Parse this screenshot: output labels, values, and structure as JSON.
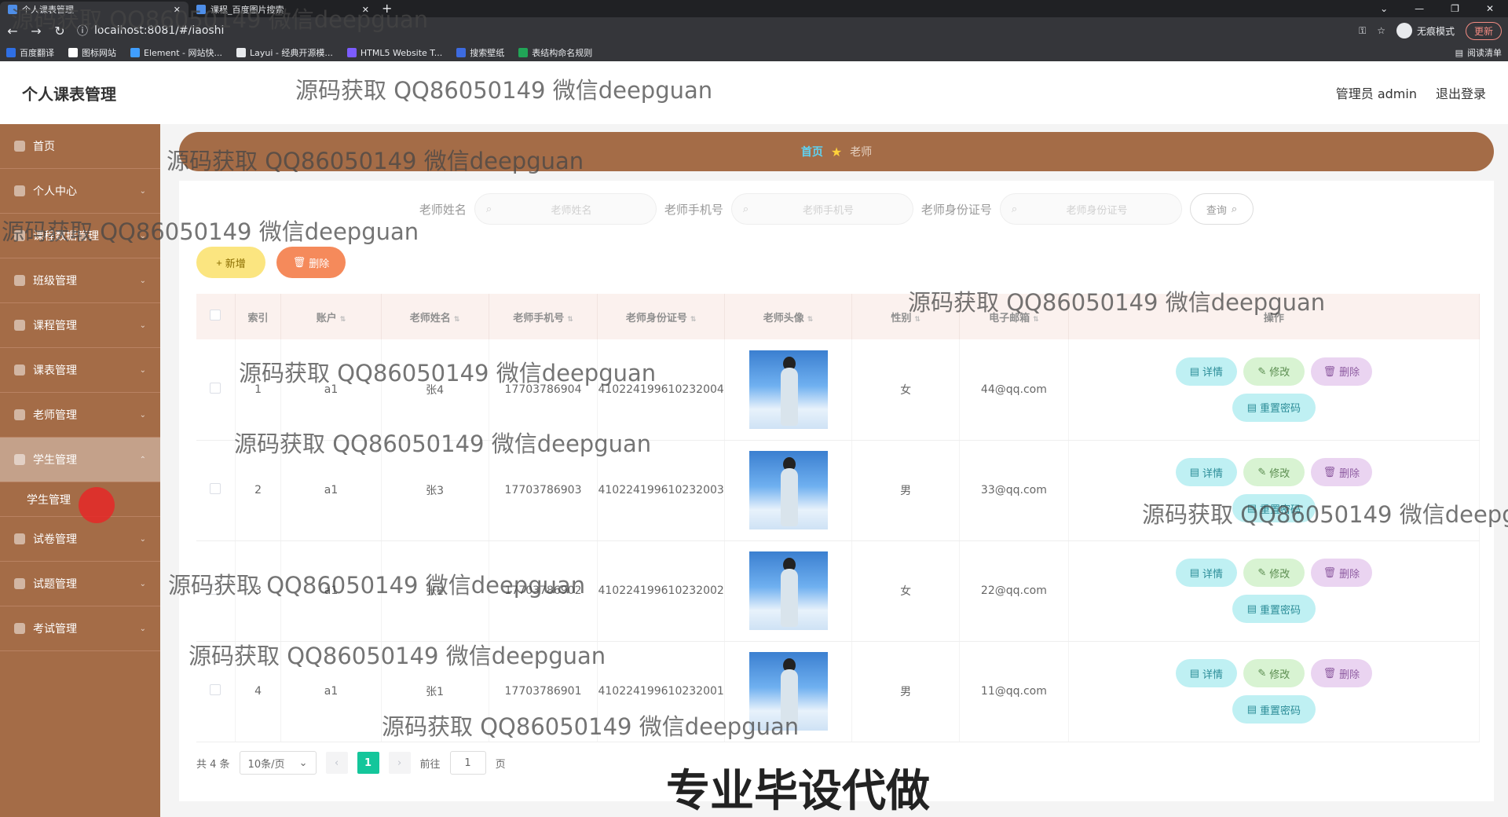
{
  "browser": {
    "tabs": [
      {
        "label": "个人课表管理",
        "active": true
      },
      {
        "label": "课程_百度图片搜索",
        "active": false
      }
    ],
    "url": "localhost:8081/#/laoshi",
    "incognito_label": "无痕模式",
    "update_label": "更新",
    "bookmarks": [
      {
        "label": "百度翻译",
        "color": "#2f6fe4"
      },
      {
        "label": "图标网站",
        "color": "#ffffff"
      },
      {
        "label": "Element - 网站快...",
        "color": "#409eff"
      },
      {
        "label": "Layui - 经典开源模...",
        "color": "#e8eaed"
      },
      {
        "label": "HTML5 Website T...",
        "color": "#7c5cff"
      },
      {
        "label": "搜索壁纸",
        "color": "#3d6be0"
      },
      {
        "label": "表结构命名规则",
        "color": "#21a557"
      }
    ],
    "reading_list": "阅读清单"
  },
  "header": {
    "title": "个人课表管理",
    "user": "管理员 admin",
    "logout": "退出登录"
  },
  "sidebar": {
    "items": [
      {
        "label": "首页"
      },
      {
        "label": "个人中心"
      },
      {
        "label": "课程数据管理"
      },
      {
        "label": "班级管理"
      },
      {
        "label": "课程管理"
      },
      {
        "label": "课表管理"
      },
      {
        "label": "老师管理"
      },
      {
        "label": "学生管理"
      },
      {
        "label": "试卷管理"
      },
      {
        "label": "试题管理"
      },
      {
        "label": "考试管理"
      }
    ],
    "submenu": "学生管理"
  },
  "breadcrumb": {
    "home": "首页",
    "current": "老师"
  },
  "search": {
    "name_label": "老师姓名",
    "name_placeholder": "老师姓名",
    "phone_label": "老师手机号",
    "phone_placeholder": "老师手机号",
    "idcard_label": "老师身份证号",
    "idcard_placeholder": "老师身份证号",
    "query_button": "查询"
  },
  "actions": {
    "add": "新增",
    "delete": "删除"
  },
  "table": {
    "headers": [
      "索引",
      "账户",
      "老师姓名",
      "老师手机号",
      "老师身份证号",
      "老师头像",
      "性别",
      "电子邮箱",
      "操作"
    ],
    "rows": [
      {
        "index": "1",
        "account": "a1",
        "name": "张4",
        "phone": "17703786904",
        "idcard": "410224199610232004",
        "gender": "女",
        "email": "44@qq.com"
      },
      {
        "index": "2",
        "account": "a1",
        "name": "张3",
        "phone": "17703786903",
        "idcard": "410224199610232003",
        "gender": "男",
        "email": "33@qq.com"
      },
      {
        "index": "3",
        "account": "a1",
        "name": "张2",
        "phone": "17703786902",
        "idcard": "410224199610232002",
        "gender": "女",
        "email": "22@qq.com"
      },
      {
        "index": "4",
        "account": "a1",
        "name": "张1",
        "phone": "17703786901",
        "idcard": "410224199610232001",
        "gender": "男",
        "email": "11@qq.com"
      }
    ],
    "op_labels": {
      "detail": "详情",
      "edit": "修改",
      "remove": "删除",
      "reset": "重置密码"
    }
  },
  "pagination": {
    "total": "共 4 条",
    "page_size": "10条/页",
    "current_page": "1",
    "goto_label": "前往",
    "goto_value": "1",
    "page_suffix": "页"
  },
  "overlay": {
    "watermark": "源码获取 QQ86050149 微信deepguan",
    "promo": "专业毕设代做"
  },
  "colors": {
    "sidebar": "#a46c47",
    "accent": "#14c69b",
    "add_button": "#fbe580",
    "delete_button": "#f58a5b"
  }
}
